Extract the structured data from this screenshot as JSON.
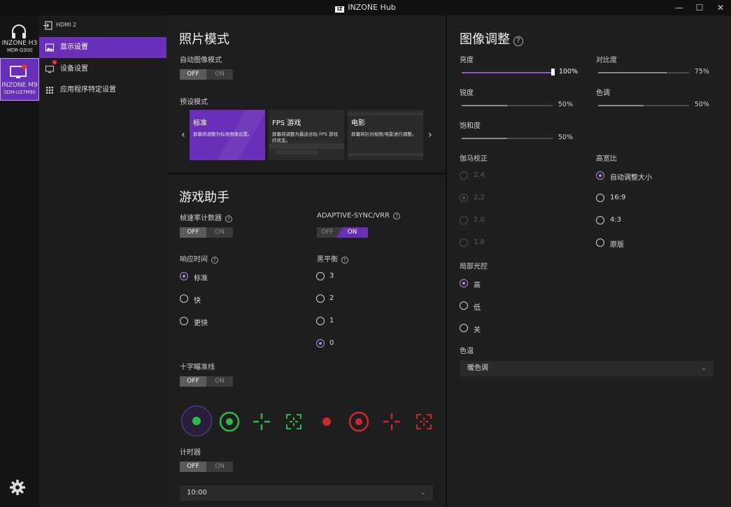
{
  "window": {
    "title": "INZONE Hub",
    "logo_text": "IZ",
    "buttons": {
      "minimize": "—",
      "maximize": "☐",
      "close": "✕"
    }
  },
  "devices": [
    {
      "name": "INZONE H3",
      "model": "MDR-G300"
    },
    {
      "name": "INZONE M9",
      "model": "SDM-U27M90"
    }
  ],
  "nav": {
    "input": "HDMI 2",
    "items": [
      {
        "label": "显示设置"
      },
      {
        "label": "设备设置"
      },
      {
        "label": "应用程序特定设置"
      }
    ]
  },
  "picture_mode": {
    "title": "照片模式",
    "auto_label": "自动图像模式",
    "off": "OFF",
    "on": "ON",
    "preset_label": "预设模式",
    "arrow_left": "‹",
    "arrow_right": "›",
    "presets": [
      {
        "title": "标准",
        "desc": "屏幕将调整为标准图像设置。"
      },
      {
        "title": "FPS 游戏",
        "desc": "屏幕将调整为最适合玩 FPS 游戏的状态。"
      },
      {
        "title": "电影",
        "desc": "屏幕将针对视频/电影进行调整。"
      }
    ]
  },
  "game_assist": {
    "title": "游戏助手",
    "fps_counter": "帧速率计数器",
    "adaptive_sync": "ADAPTIVE-SYNC/VRR",
    "response_time": "响应时间",
    "response_options": [
      "标准",
      "快",
      "更快"
    ],
    "black_equalizer": "黑平衡",
    "black_options": [
      "3",
      "2",
      "1",
      "0"
    ],
    "crosshair": "十字瞄准线",
    "timer": "计时器",
    "timer_value": "10:00",
    "colors": {
      "green": "#2fb84a",
      "red": "#c8292c"
    }
  },
  "image_adjust": {
    "title": "图像调整",
    "brightness": {
      "label": "亮度",
      "value": "100%"
    },
    "contrast": {
      "label": "对比度",
      "value": "75%"
    },
    "sharpness": {
      "label": "锐度",
      "value": "50%"
    },
    "hue": {
      "label": "色调",
      "value": "50%"
    },
    "saturation": {
      "label": "饱和度",
      "value": "50%"
    },
    "gamma_label": "伽马校正",
    "gamma_options": [
      "2.4",
      "2.2",
      "2.0",
      "1.8"
    ],
    "aspect_label": "高宽比",
    "aspect_options": [
      "自动调整大小",
      "16:9",
      "4:3",
      "原版"
    ],
    "local_dimming_label": "局部光控",
    "local_dimming_options": [
      "高",
      "低",
      "关"
    ],
    "color_temp_label": "色温",
    "color_temp_value": "暖色调",
    "accent": "#6a2fb8"
  },
  "footer": {
    "settings_icon": "gear-icon"
  }
}
